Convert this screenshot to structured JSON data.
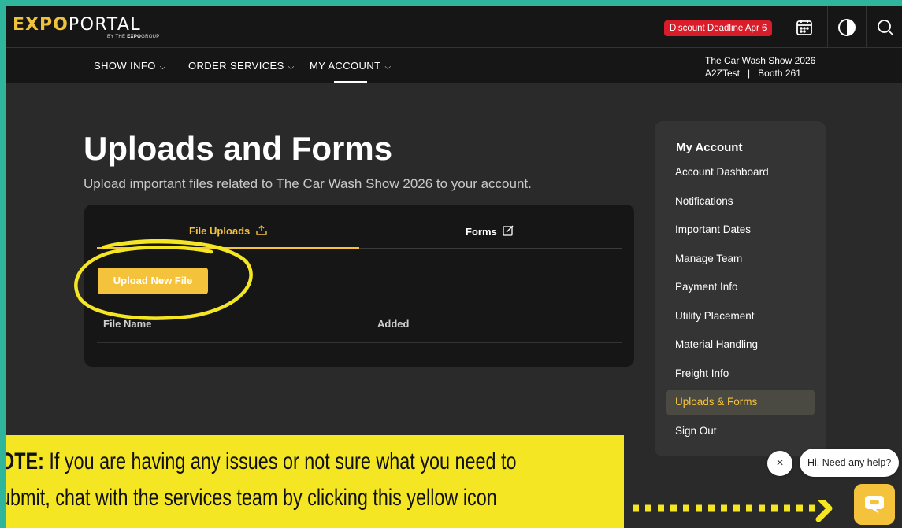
{
  "header": {
    "logo_expo": "EXPO",
    "logo_portal": "PORTAL",
    "logo_sub_prefix": "BY THE",
    "logo_sub_brand": "EXPO",
    "logo_sub_suffix": "GROUP",
    "deadline_badge": "Discount Deadline Apr 6",
    "icons": [
      "calendar-icon",
      "theme-toggle-icon",
      "search-icon"
    ]
  },
  "nav": {
    "items": [
      {
        "label": "SHOW INFO"
      },
      {
        "label": "ORDER SERVICES"
      },
      {
        "label": "MY ACCOUNT"
      }
    ],
    "show_name": "The Car Wash Show 2026",
    "company": "A2ZTest",
    "separator": "|",
    "booth": "Booth 261"
  },
  "main": {
    "title": "Uploads and Forms",
    "subtitle": "Upload important files related to The Car Wash Show 2026 to your account.",
    "tabs": [
      {
        "label": "File Uploads",
        "icon": "upload-icon"
      },
      {
        "label": "Forms",
        "icon": "edit-icon"
      }
    ],
    "upload_button": "Upload New File",
    "columns": [
      "File Name",
      "Added"
    ]
  },
  "sidebar": {
    "title": "My Account",
    "items": [
      {
        "label": "Account Dashboard"
      },
      {
        "label": "Notifications"
      },
      {
        "label": "Important Dates"
      },
      {
        "label": "Manage Team"
      },
      {
        "label": "Payment Info"
      },
      {
        "label": "Utility Placement"
      },
      {
        "label": "Material Handling"
      },
      {
        "label": "Freight Info"
      },
      {
        "label": "Uploads & Forms"
      },
      {
        "label": "Sign Out"
      }
    ],
    "active": "Uploads & Forms"
  },
  "note": {
    "label": "OTE:",
    "line1": " If you are having any issues or not sure what you need to",
    "line2": "ubmit, chat with the services team by clicking this yellow icon"
  },
  "chat": {
    "bubble_text": "Hi. Need any help?",
    "close_glyph": "×"
  },
  "colors": {
    "accent": "#f5c33b",
    "deadline": "#d81c2a",
    "note_bg": "#f5e624",
    "border": "#2fb59b"
  }
}
